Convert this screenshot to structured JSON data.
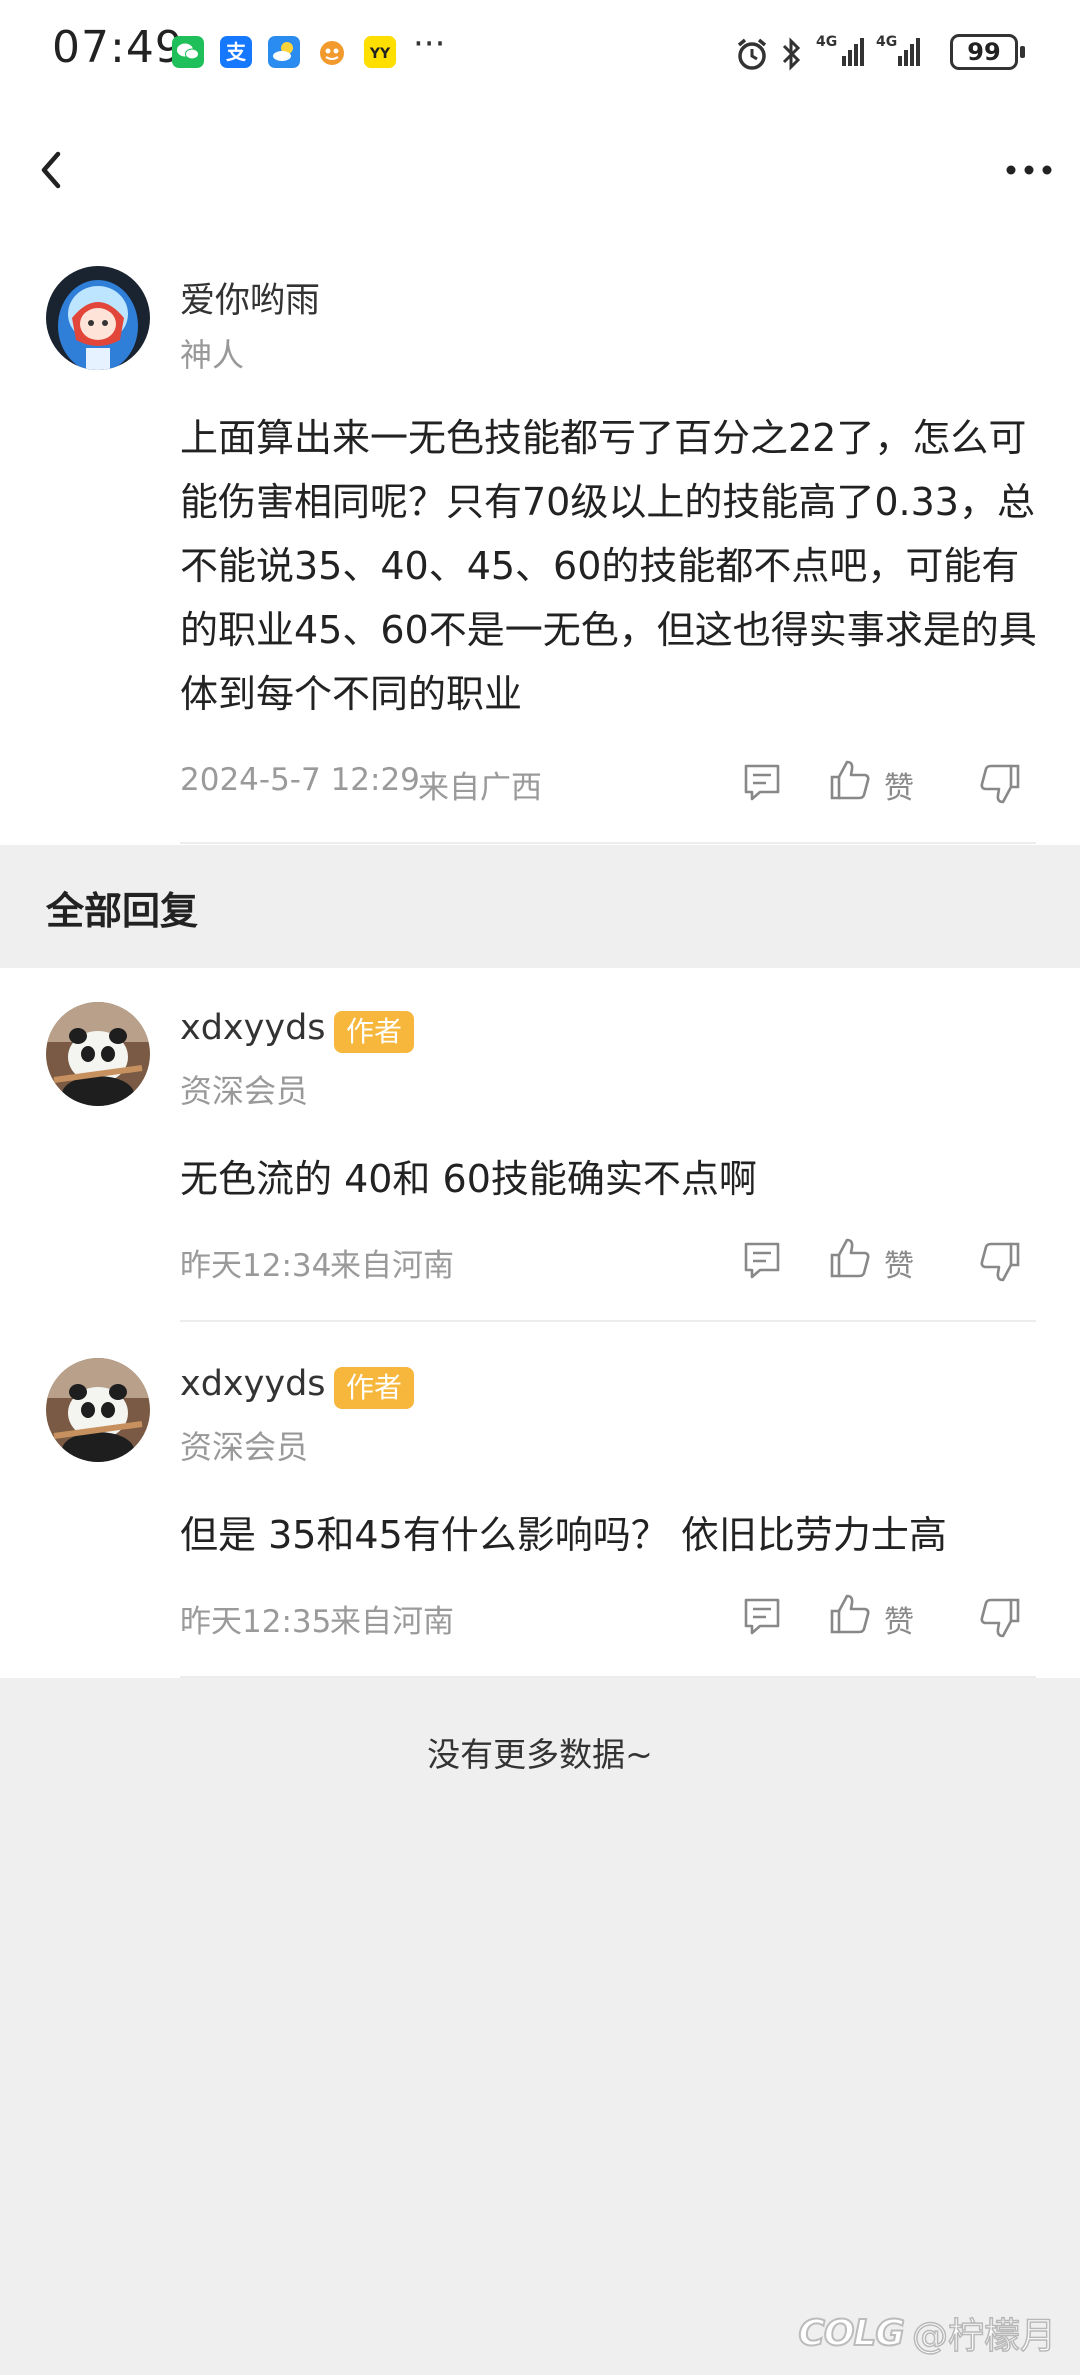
{
  "status_bar": {
    "time": "07:49",
    "dots": "···",
    "signal_1": "4G",
    "signal_2": "4G",
    "battery": "99",
    "app_icons": [
      "wechat-icon",
      "alipay-icon",
      "weather-app-icon",
      "game-app-icon",
      "yy-app-icon"
    ],
    "system_icons": [
      "alarm-icon",
      "bluetooth-icon",
      "signal-4g-icon",
      "signal-4g-icon",
      "battery-icon"
    ]
  },
  "nav": {
    "back_icon": "chevron-left-icon",
    "more_icon": "more-dots-icon"
  },
  "main_comment": {
    "author": "爱你哟雨",
    "title": "神人",
    "text": "上面算出来一无色技能都亏了百分之22了，怎么可能伤害相同呢？只有70级以上的技能高了0.33，总不能说35、40、45、60的技能都不点吧，可能有的职业45、60不是一无色，但这也得实事求是的具体到每个不同的职业",
    "time": "2024-5-7 12:29",
    "location": "来自广西",
    "like_label": "赞"
  },
  "section_title": "全部回复",
  "replies": [
    {
      "author": "xdxyyds",
      "badge": "作者",
      "title": "资深会员",
      "text": "无色流的 40和 60技能确实不点啊",
      "time": "昨天12:34",
      "location": "来自河南",
      "like_label": "赞"
    },
    {
      "author": "xdxyyds",
      "badge": "作者",
      "title": "资深会员",
      "text": "但是 35和45有什么影响吗？  依旧比劳力士高",
      "time": "昨天12:35",
      "location": "来自河南",
      "like_label": "赞"
    }
  ],
  "footer": {
    "no_more": "没有更多数据~"
  },
  "watermark": {
    "logo": "COLG",
    "text": "@柠檬月"
  },
  "colors": {
    "badge": "#f6b73c",
    "page_bg": "#efefef",
    "card_bg": "#ffffff",
    "meta_text": "#9a9a9a"
  }
}
